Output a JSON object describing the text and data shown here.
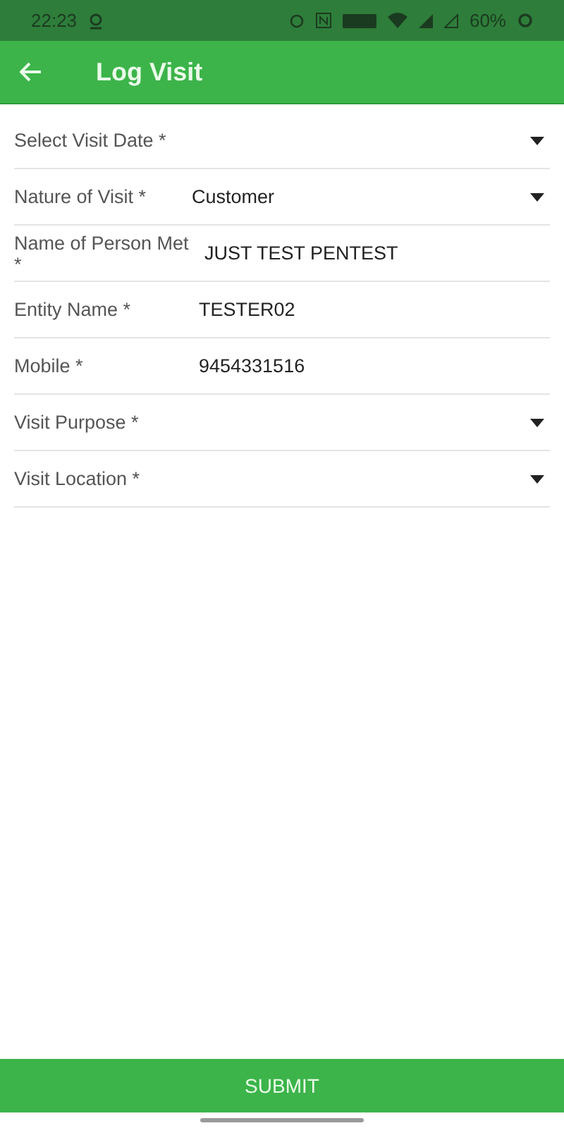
{
  "status_bar": {
    "time": "22:23",
    "battery": "60%"
  },
  "app_bar": {
    "title": "Log Visit"
  },
  "fields": [
    {
      "kind": "dropdown",
      "label": "Select Visit Date *"
    },
    {
      "kind": "dropdown",
      "label": "Nature of Visit *",
      "value": "Customer"
    },
    {
      "kind": "text",
      "label": "Name of Person Met *",
      "value": "JUST TEST PENTEST"
    },
    {
      "kind": "text",
      "label": "Entity Name *",
      "value": "TESTER02"
    },
    {
      "kind": "text",
      "label": "Mobile *",
      "value": "9454331516"
    },
    {
      "kind": "dropdown",
      "label": "Visit Purpose *"
    },
    {
      "kind": "dropdown",
      "label": "Visit Location *"
    }
  ],
  "submit_button": "SUBMIT"
}
